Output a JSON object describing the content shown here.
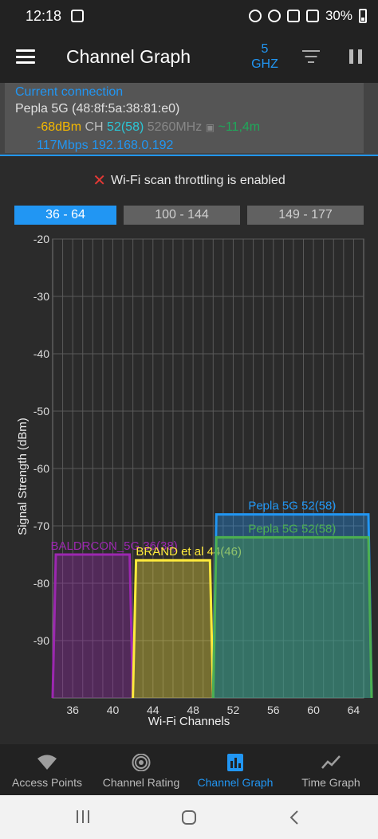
{
  "status_bar": {
    "time": "12:18",
    "battery": "30%"
  },
  "app_bar": {
    "title": "Channel Graph",
    "band_line1": "5",
    "band_line2": "GHZ"
  },
  "connection": {
    "label": "Current connection",
    "ssid": "Pepla 5G (48:8f:5a:38:81:e0)",
    "signal": "-68dBm",
    "ch_label": "CH",
    "channel": "52(58)",
    "frequency": "5260MHz",
    "distance": "~11,4m",
    "speed_ip": "117Mbps 192.168.0.192"
  },
  "throttle_message": "Wi-Fi scan throttling is enabled",
  "tabs": [
    {
      "label": "36 - 64",
      "active": true
    },
    {
      "label": "100 - 144",
      "active": false
    },
    {
      "label": "149 - 177",
      "active": false
    }
  ],
  "chart_data": {
    "type": "area",
    "xlabel": "Wi-Fi Channels",
    "ylabel": "Signal Strength (dBm)",
    "xlim": [
      34,
      65
    ],
    "ylim": [
      -100,
      -20
    ],
    "y_ticks": [
      -20,
      -30,
      -40,
      -50,
      -60,
      -70,
      -80,
      -90
    ],
    "x_ticks": [
      36,
      40,
      44,
      48,
      52,
      56,
      60,
      64
    ],
    "grid": true,
    "series": [
      {
        "name": "BALDRCON_5G 36(38)",
        "color": "#9c27b0",
        "ch_start": 34,
        "ch_end": 42,
        "signal": -75
      },
      {
        "name": "BRAND et al 44(46)",
        "color": "#ffeb3b",
        "ch_start": 42,
        "ch_end": 50,
        "signal": -76
      },
      {
        "name": "Pepla 5G 52(58)",
        "color": "#2196f3",
        "ch_start": 50,
        "ch_end": 66,
        "signal": -68
      },
      {
        "name": "Pepla 5G 52(58)",
        "color": "#4caf50",
        "ch_start": 50,
        "ch_end": 66,
        "signal": -72
      }
    ]
  },
  "bottom_nav": [
    {
      "label": "Access Points",
      "icon": "wifi-icon",
      "active": false
    },
    {
      "label": "Channel Rating",
      "icon": "signal-rating-icon",
      "active": false
    },
    {
      "label": "Channel Graph",
      "icon": "bar-chart-icon",
      "active": true
    },
    {
      "label": "Time Graph",
      "icon": "line-graph-icon",
      "active": false
    }
  ],
  "colors": {
    "accent": "#2196f3",
    "background": "#2b2b2b"
  }
}
